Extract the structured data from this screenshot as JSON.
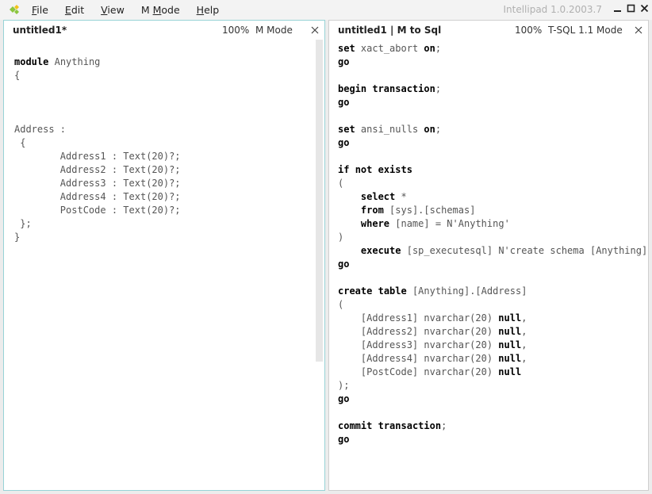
{
  "app": {
    "title": "Intellipad 1.0.2003.7",
    "logo_icon": "diamond-logo-icon"
  },
  "menu": {
    "items": [
      {
        "label_pre": "",
        "accel": "F",
        "label_post": "ile"
      },
      {
        "label_pre": "",
        "accel": "E",
        "label_post": "dit"
      },
      {
        "label_pre": "",
        "accel": "V",
        "label_post": "iew"
      },
      {
        "label_pre": "M ",
        "accel": "M",
        "label_post": "ode"
      },
      {
        "label_pre": "",
        "accel": "H",
        "label_post": "elp"
      }
    ]
  },
  "left_pane": {
    "title": "untitled1*",
    "zoom": "100%",
    "mode": "M Mode",
    "lines": [
      "module Anything",
      "{",
      "",
      "",
      "",
      "Address :",
      " {",
      "        Address1 : Text(20)?;",
      "        Address2 : Text(20)?;",
      "        Address3 : Text(20)?;",
      "        Address4 : Text(20)?;",
      "        PostCode : Text(20)?;",
      " };",
      "}"
    ]
  },
  "right_pane": {
    "title": "untitled1 | M to Sql",
    "zoom": "100%",
    "mode": "T-SQL 1.1 Mode",
    "lines": [
      "set xact_abort on;",
      "go",
      "",
      "begin transaction;",
      "go",
      "",
      "set ansi_nulls on;",
      "go",
      "",
      "if not exists",
      "(",
      "    select *",
      "    from [sys].[schemas]",
      "    where [name] = N'Anything'",
      ")",
      "    execute [sp_executesql] N'create schema [Anything]'",
      "go",
      "",
      "create table [Anything].[Address]",
      "(",
      "    [Address1] nvarchar(20) null,",
      "    [Address2] nvarchar(20) null,",
      "    [Address3] nvarchar(20) null,",
      "    [Address4] nvarchar(20) null,",
      "    [PostCode] nvarchar(20) null",
      ");",
      "go",
      "",
      "commit transaction;",
      "go"
    ]
  },
  "colors": {
    "active_border": "#97d3d6",
    "logo_green": "#8cc63e",
    "logo_yellow": "#f2c318"
  }
}
